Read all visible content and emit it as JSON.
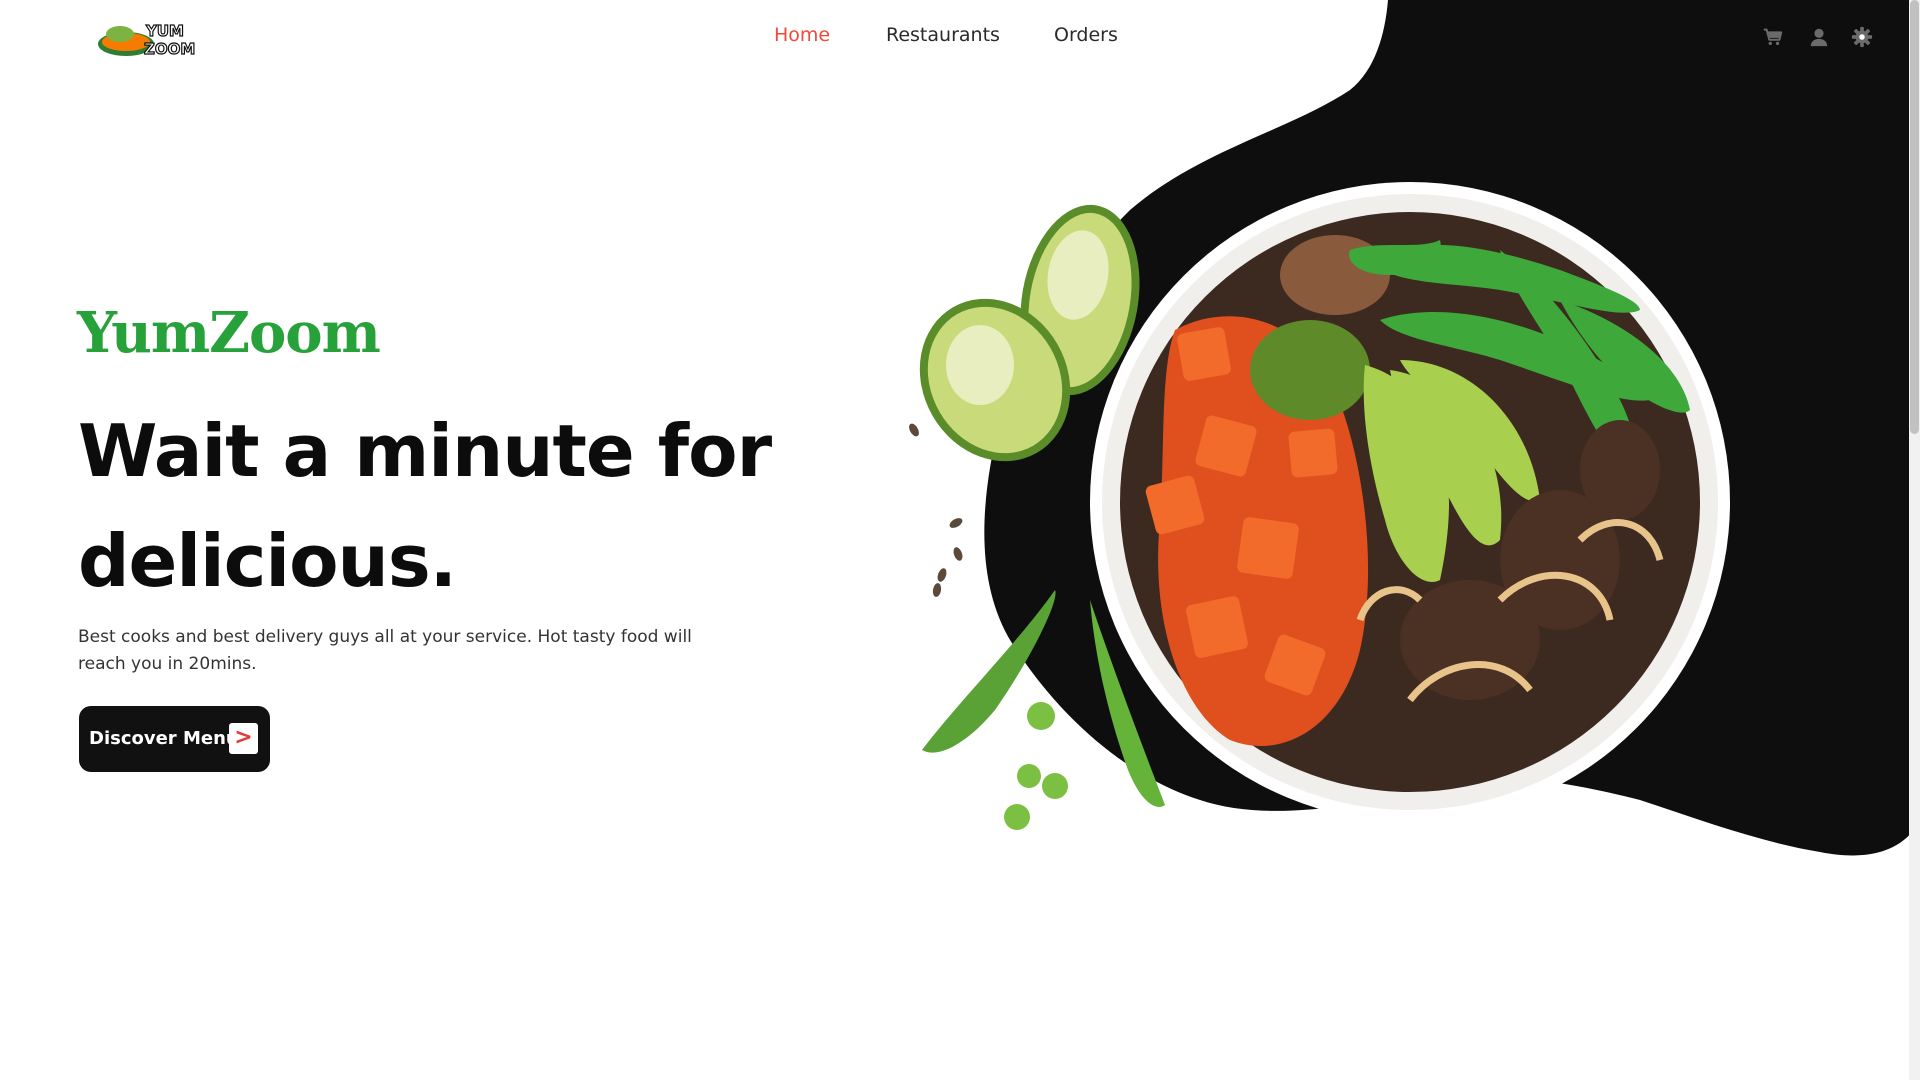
{
  "header": {
    "logo_text": "YUMZOOM",
    "nav": [
      {
        "label": "Home",
        "active": true
      },
      {
        "label": "Restaurants",
        "active": false
      },
      {
        "label": "Orders",
        "active": false
      }
    ],
    "icons": [
      "cart-icon",
      "user-icon",
      "settings-icon"
    ]
  },
  "hero": {
    "brand": "YumZoom",
    "headline_line1": "Wait a minute for",
    "headline_line2": "delicious.",
    "subtext": "Best cooks and best delivery guys all at your service. Hot tasty food will reach you in 20mins.",
    "cta_label": "Discover Menu",
    "cta_arrow": ">"
  },
  "colors": {
    "accent": "#f04a3a",
    "brand_green": "#27a13a",
    "dark": "#0c0c0c"
  }
}
